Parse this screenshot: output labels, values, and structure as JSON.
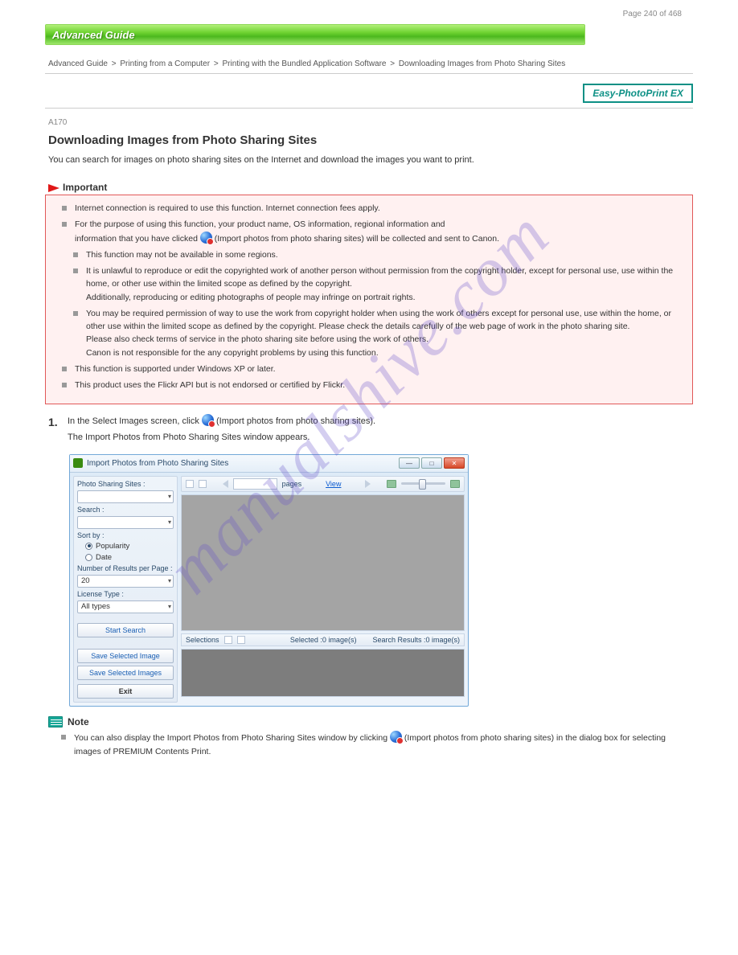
{
  "page_number_header": "Page 240 of 468",
  "header": {
    "title": "Advanced Guide"
  },
  "breadcrumb": {
    "parts": [
      "Advanced Guide",
      "Printing from a Computer",
      "Printing with the Bundled Application Software",
      "Downloading Images from Photo Sharing Sites"
    ],
    "sep": ">"
  },
  "badge": "Easy-PhotoPrint EX",
  "doc_code": "A170",
  "title": "Downloading Images from Photo Sharing Sites",
  "para1": "You can search for images on photo sharing sites on the Internet and download the images you want to print.",
  "important_label": "Important",
  "important": [
    "Internet connection is required to use this function. Internet connection fees apply.",
    "For the purpose of using this function, your product name, OS information, regional information and information that you have clicked  (Import photos from photo sharing sites) will be collected and sent to Canon.",
    "This function may not be available in some regions.",
    "It is unlawful to reproduce or edit the copyrighted work of another person without permission from the copyright holder, except for personal use, use within the home, or other use within the limited scope as defined by the copyright.\nAdditionally, reproducing or editing photographs of people may infringe on portrait rights.",
    "You may be required permission of way to use the work from copyright holder when using the work of others except for personal use, use within the home, or other use within the limited scope as defined by the copyright. Please check the details carefully of the web page of work in the photo sharing site.\nPlease also check terms of service in the photo sharing site before using the work of others.\nCanon is not responsible for the any copyright problems by using this function.",
    "This function is supported under Windows XP or later.",
    "This product uses the Flickr API but is not endorsed or certified by Flickr."
  ],
  "step1": {
    "num": "1.",
    "line1": "In the Select Images screen, click  (Import photos from photo sharing sites).",
    "line2": "The Import Photos from Photo Sharing Sites window appears."
  },
  "window": {
    "title": "Import Photos from Photo Sharing Sites",
    "labels": {
      "sites": "Photo Sharing Sites :",
      "search": "Search :",
      "sortby": "Sort by :",
      "popularity": "Popularity",
      "date": "Date",
      "numresults": "Number of Results per Page :",
      "numresults_val": "20",
      "license": "License Type :",
      "license_val": "All types",
      "start": "Start Search",
      "saveone": "Save Selected Image",
      "savemany": "Save Selected Images",
      "exit": "Exit"
    },
    "toolbar": {
      "pages": "pages",
      "view": "View"
    },
    "selbar": {
      "label": "Selections",
      "sel": "Selected :0 image(s)",
      "res": "Search Results :0 image(s)"
    }
  },
  "note_label": "Note",
  "note": {
    "line": "You can also display the Import Photos from Photo Sharing Sites window by clicking  (Import photos from photo sharing sites) in the dialog box for selecting images of PREMIUM Contents Print."
  }
}
